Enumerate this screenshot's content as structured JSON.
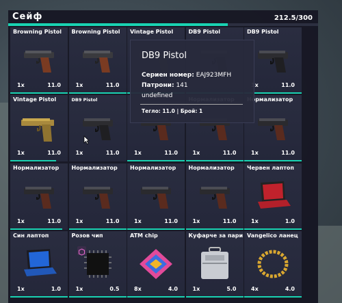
{
  "title": "Сейф",
  "capacity": {
    "label": "212.5/300",
    "fraction": 0.708
  },
  "accent": "#19d3b2",
  "slots": [
    {
      "name": "Browning Pistol",
      "qty": "1x",
      "weight": "11.0",
      "icon": "pistol-brown-grip",
      "durability": 1.0
    },
    {
      "name": "Browning Pistol",
      "qty": "1x",
      "weight": "11.0",
      "icon": "pistol-brown-grip",
      "durability": 1.0
    },
    {
      "name": "Vintage Pistol",
      "qty": "",
      "weight": "",
      "icon": "pistol-vintage",
      "durability": 1.0
    },
    {
      "name": "DB9 Pistol",
      "qty": "",
      "weight": "",
      "icon": "pistol-compact",
      "durability": 1.0
    },
    {
      "name": "DB9 Pistol",
      "qty": "1x",
      "weight": "11.0",
      "icon": "pistol-compact",
      "durability": 1.0
    },
    {
      "name": "Vintage Pistol",
      "qty": "1x",
      "weight": "11.0",
      "icon": "pistol-vintage-gold",
      "durability": 0.8
    },
    {
      "name": "DB9 Pistol",
      "qty": "1x",
      "weight": "11.0",
      "icon": "pistol-compact",
      "durability": 0.0
    },
    {
      "name": "",
      "qty": "1x",
      "weight": "11.0",
      "icon": "pistol-black",
      "durability": 1.0
    },
    {
      "name": "Нормализатор",
      "qty": "1x",
      "weight": "11.0",
      "icon": "pistol-black",
      "durability": 1.0
    },
    {
      "name": "Нормализатор",
      "qty": "1x",
      "weight": "11.0",
      "icon": "pistol-black",
      "durability": 1.0
    },
    {
      "name": "Нормализатор",
      "qty": "1x",
      "weight": "11.0",
      "icon": "pistol-black",
      "durability": 0.9
    },
    {
      "name": "Нормализатор",
      "qty": "1x",
      "weight": "11.0",
      "icon": "pistol-black",
      "durability": 1.0
    },
    {
      "name": "Нормализатор",
      "qty": "1x",
      "weight": "11.0",
      "icon": "pistol-black",
      "durability": 1.0
    },
    {
      "name": "Нормализатор",
      "qty": "1x",
      "weight": "11.0",
      "icon": "pistol-black",
      "durability": 1.0
    },
    {
      "name": "Червен лаптоп",
      "qty": "1x",
      "weight": "1.0",
      "icon": "laptop-red",
      "durability": 1.0
    },
    {
      "name": "Син лаптоп",
      "qty": "1x",
      "weight": "1.0",
      "icon": "laptop-blue",
      "durability": 1.0
    },
    {
      "name": "Розов чип",
      "qty": "1x",
      "weight": "0.5",
      "icon": "chip-black",
      "durability": 1.0
    },
    {
      "name": "ATM chip",
      "qty": "8x",
      "weight": "4.0",
      "icon": "chip-rainbow",
      "durability": 1.0
    },
    {
      "name": "Куфарче за пари",
      "qty": "1x",
      "weight": "5.0",
      "icon": "briefcase-silver",
      "durability": 1.0
    },
    {
      "name": "Vangelico ланец",
      "qty": "4x",
      "weight": "4.0",
      "icon": "gold-chain",
      "durability": 1.0
    }
  ],
  "tooltip": {
    "title": "DB9 Pistol",
    "serial_label": "Сериен номер:",
    "serial_value": "EAJ923MFH",
    "ammo_label": "Патрони:",
    "ammo_value": "141",
    "extra": "undefined",
    "footer": "Тегло: 11.0 | Брой: 1"
  }
}
